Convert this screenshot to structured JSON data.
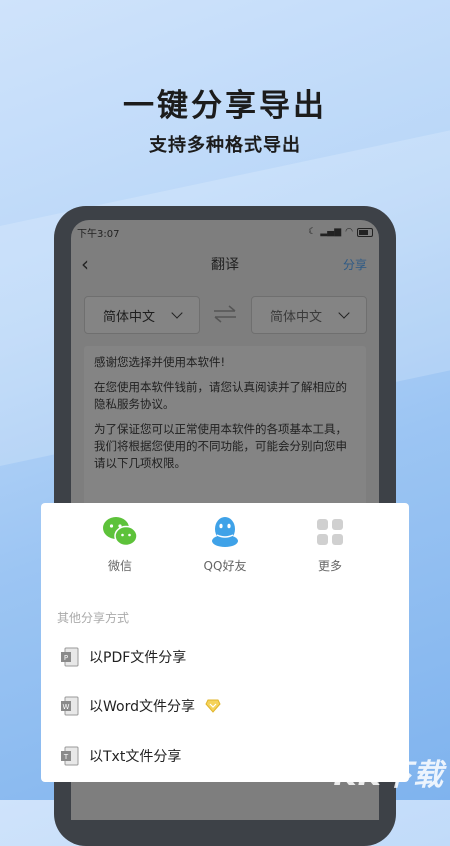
{
  "hero": {
    "title": "一键分享导出",
    "subtitle": "支持多种格式导出"
  },
  "status": {
    "time": "下午3:07"
  },
  "nav": {
    "title": "翻译",
    "share": "分享"
  },
  "lang": {
    "source": "简体中文",
    "target": "简体中文"
  },
  "content": {
    "p1": "感谢您选择并使用本软件!",
    "p2": "在您使用本软件钱前，请您认真阅读并了解相应的隐私服务协议。",
    "p3": "为了保证您可以正常使用本软件的各项基本工具，我们将根据您使用的不同功能，可能会分别向您申请以下几项权限。"
  },
  "sheet": {
    "apps": [
      {
        "label": "微信",
        "icon": "wechat-icon",
        "color": "#5dc23a"
      },
      {
        "label": "QQ好友",
        "icon": "qq-icon",
        "color": "#3fa2e8"
      },
      {
        "label": "更多",
        "icon": "grid-icon",
        "color": "#cccccc"
      }
    ],
    "other_title": "其他分享方式",
    "options": [
      {
        "label": "以PDF文件分享",
        "icon": "pdf-file-icon"
      },
      {
        "label": "以Word文件分享",
        "icon": "word-file-icon"
      },
      {
        "label": "以Txt文件分享",
        "icon": "txt-file-icon"
      }
    ]
  },
  "watermark": "KK下载"
}
